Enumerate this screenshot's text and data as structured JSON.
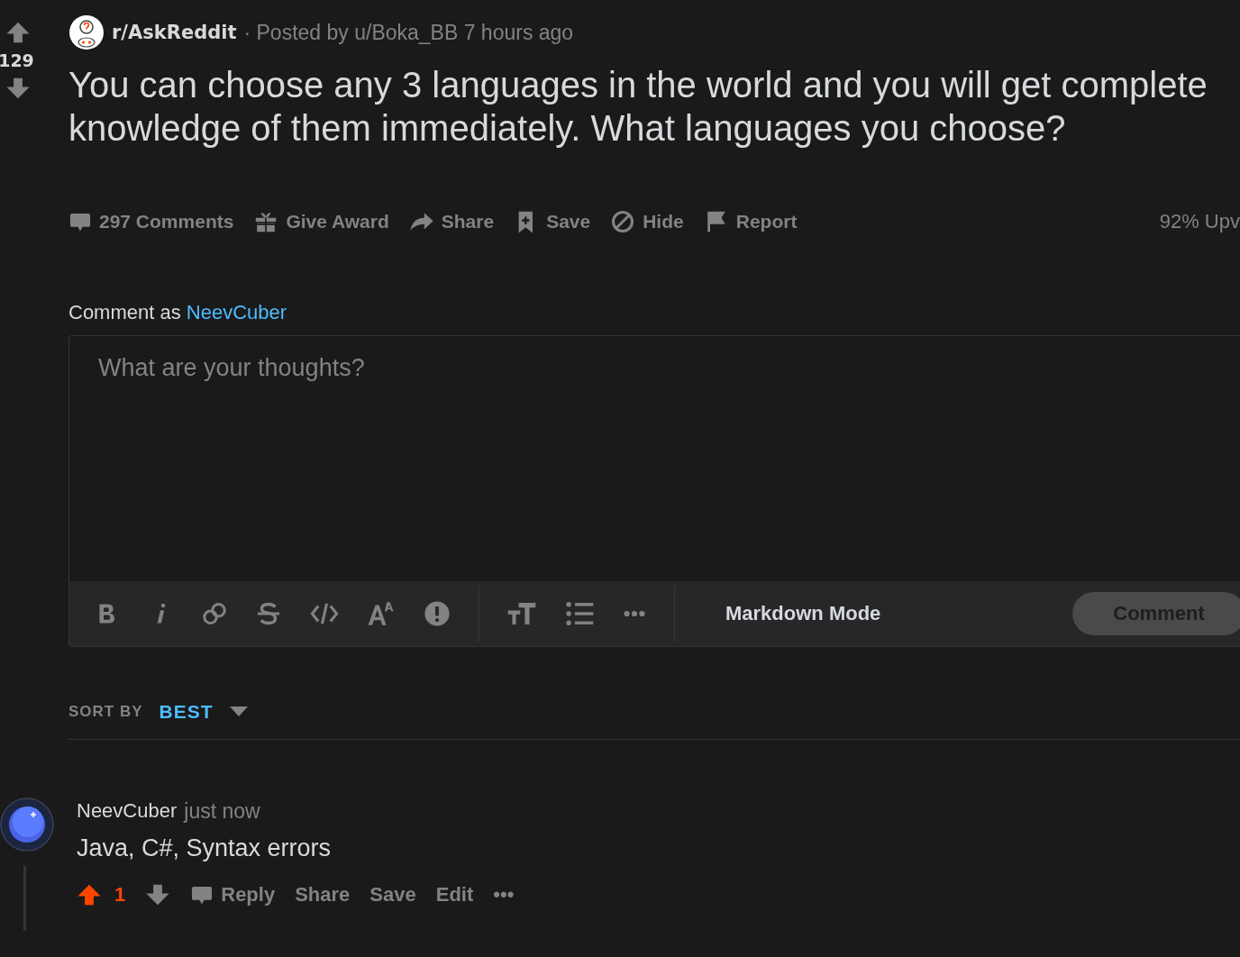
{
  "post": {
    "upvoted": false,
    "score": "129",
    "subreddit": "r/AskReddit",
    "meta": "· Posted by u/Boka_BB 7 hours ago",
    "title": "You can choose any 3 languages in the world and you will get complete knowledge of them immediately. What languages you choose?",
    "actions": [
      {
        "kind": "comments",
        "label": "297 Comments"
      },
      {
        "kind": "award",
        "label": "Give Award"
      },
      {
        "kind": "share",
        "label": "Share"
      },
      {
        "kind": "save",
        "label": "Save"
      },
      {
        "kind": "hide",
        "label": "Hide"
      },
      {
        "kind": "report",
        "label": "Report"
      }
    ],
    "upvote_ratio": "92% Upv"
  },
  "composer": {
    "prefix": "Comment as",
    "user": "NeevCuber",
    "placeholder": "What are your thoughts?",
    "tools": [
      {
        "kind": "bold"
      },
      {
        "kind": "italic"
      },
      {
        "kind": "link"
      },
      {
        "kind": "strike"
      },
      {
        "kind": "code"
      },
      {
        "kind": "superscript"
      },
      {
        "kind": "spoiler"
      },
      {
        "kind": "divider"
      },
      {
        "kind": "heading"
      },
      {
        "kind": "list"
      },
      {
        "kind": "more"
      },
      {
        "kind": "divider"
      }
    ],
    "mode_button": "Markdown Mode",
    "submit": {
      "label": "Comment",
      "disabled": true
    }
  },
  "sort": {
    "label": "SORT BY",
    "value": "BEST"
  },
  "comment": {
    "author": "NeevCuber",
    "time": "just now",
    "body": "Java, C#, Syntax errors",
    "upvoted": true,
    "score": "1",
    "actions": [
      {
        "kind": "reply",
        "label": "Reply"
      },
      {
        "kind": "text",
        "label": "Share"
      },
      {
        "kind": "text",
        "label": "Save"
      },
      {
        "kind": "text",
        "label": "Edit"
      },
      {
        "kind": "more",
        "label": "•••"
      }
    ]
  }
}
